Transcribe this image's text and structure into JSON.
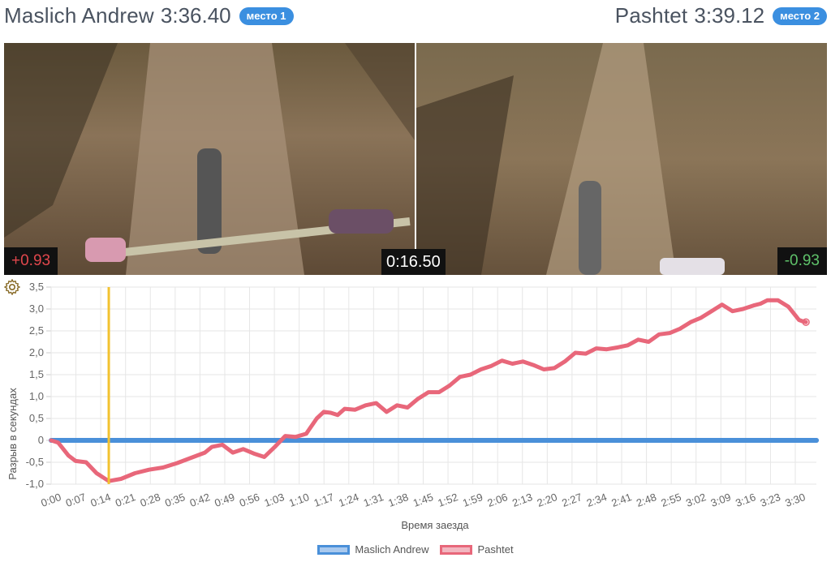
{
  "header": {
    "left": {
      "name": "Maslich Andrew",
      "time": "3:36.40",
      "place": "место 1"
    },
    "right": {
      "name": "Pashtet",
      "time": "3:39.12",
      "place": "место 2"
    }
  },
  "videos": {
    "left_delta": "+0.93",
    "right_delta": "-0.93",
    "timer": "0:16.50"
  },
  "colors": {
    "badge": "#3b8fe0",
    "series1": "#4a90d9",
    "series2": "#e8677a",
    "marker": "#f2c230"
  },
  "icons": {
    "settings": "gear-icon"
  },
  "chart_data": {
    "type": "line",
    "xlabel": "Время заезда",
    "ylabel": "Разрыв в секундах",
    "ylim": [
      -1.0,
      3.5
    ],
    "y_ticks": [
      "-1,0",
      "-0,5",
      "0",
      "0,5",
      "1,0",
      "1,5",
      "2,0",
      "2,5",
      "3,0",
      "3,5"
    ],
    "x_ticks": [
      "0:00",
      "0:07",
      "0:14",
      "0:21",
      "0:28",
      "0:35",
      "0:42",
      "0:49",
      "0:56",
      "1:03",
      "1:10",
      "1:17",
      "1:24",
      "1:31",
      "1:38",
      "1:45",
      "1:52",
      "1:59",
      "2:06",
      "2:13",
      "2:20",
      "2:27",
      "2:34",
      "2:41",
      "2:48",
      "2:55",
      "3:02",
      "3:09",
      "3:16",
      "3:23",
      "3:30"
    ],
    "xlim_seconds": [
      0,
      219
    ],
    "marker_seconds": 16.5,
    "grid": true,
    "legend_position": "bottom",
    "series": [
      {
        "name": "Maslich Andrew",
        "x": [
          0,
          219
        ],
        "y": [
          0,
          0
        ]
      },
      {
        "name": "Pashtet",
        "x": [
          0,
          2,
          5,
          7,
          10,
          13,
          16.5,
          20,
          24,
          28,
          32,
          36,
          40,
          44,
          46,
          49,
          52,
          55,
          58,
          61,
          64,
          67,
          70,
          73,
          76,
          78,
          80,
          82,
          84,
          87,
          90,
          93,
          96,
          99,
          102,
          105,
          108,
          111,
          114,
          117,
          120,
          123,
          126,
          129,
          132,
          135,
          138,
          141,
          144,
          147,
          150,
          153,
          156,
          159,
          162,
          165,
          168,
          171,
          174,
          177,
          180,
          183,
          186,
          189,
          192,
          195,
          198,
          201,
          203,
          205,
          208,
          211,
          213,
          214,
          215,
          216
        ],
        "y": [
          0,
          -0.05,
          -0.35,
          -0.47,
          -0.5,
          -0.75,
          -0.93,
          -0.88,
          -0.75,
          -0.67,
          -0.62,
          -0.52,
          -0.4,
          -0.28,
          -0.15,
          -0.1,
          -0.28,
          -0.2,
          -0.3,
          -0.38,
          -0.15,
          0.1,
          0.08,
          0.15,
          0.5,
          0.65,
          0.63,
          0.58,
          0.72,
          0.7,
          0.8,
          0.85,
          0.65,
          0.8,
          0.75,
          0.95,
          1.1,
          1.1,
          1.25,
          1.45,
          1.5,
          1.62,
          1.7,
          1.82,
          1.75,
          1.8,
          1.72,
          1.62,
          1.65,
          1.8,
          2.0,
          1.98,
          2.1,
          2.08,
          2.12,
          2.17,
          2.3,
          2.25,
          2.42,
          2.45,
          2.55,
          2.7,
          2.8,
          2.95,
          3.1,
          2.95,
          3.0,
          3.08,
          3.12,
          3.2,
          3.2,
          3.05,
          2.85,
          2.75,
          2.72,
          2.7
        ]
      }
    ]
  },
  "legend": {
    "item1": "Maslich Andrew",
    "item2": "Pashtet"
  }
}
